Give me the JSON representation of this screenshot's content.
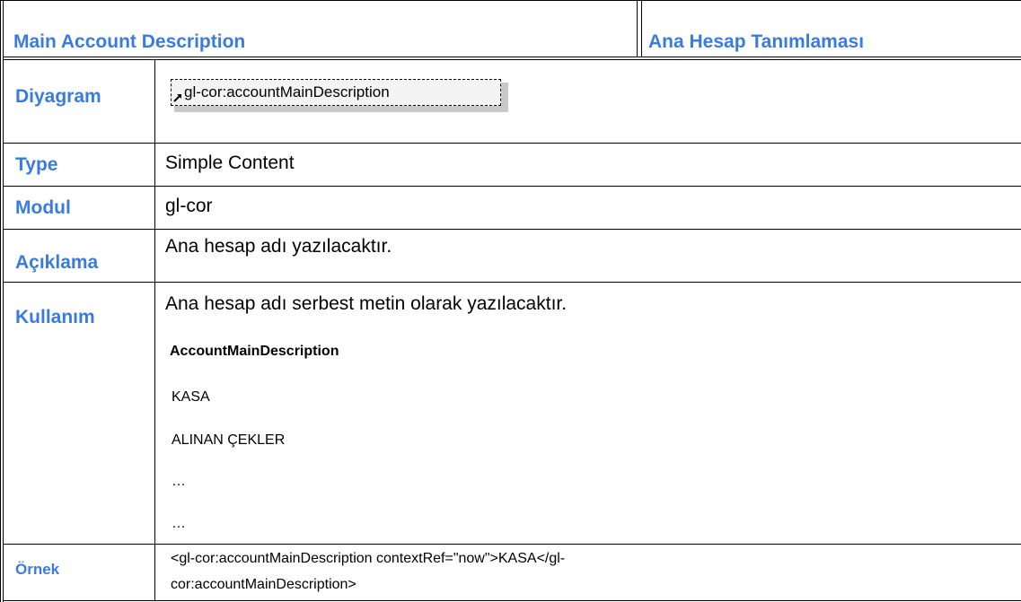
{
  "header": {
    "left_title": "Main Account Description",
    "right_title": "Ana Hesap Tanımlaması"
  },
  "rows": {
    "diagram": {
      "label": "Diyagram",
      "element_name": "gl-cor:accountMainDescription",
      "icon": "reference-arrow-icon"
    },
    "type": {
      "label": "Type",
      "value": "Simple Content"
    },
    "modul": {
      "label": "Modul",
      "value": "gl-cor"
    },
    "aciklama": {
      "label": "Açıklama",
      "value": "Ana hesap adı yazılacaktır."
    },
    "kullanim": {
      "label": "Kullanım",
      "value": "Ana hesap adı serbest metin olarak yazılacaktır.",
      "example_heading": "AccountMainDescription",
      "example_items": [
        "KASA",
        "ALINAN ÇEKLER",
        "…",
        "…"
      ]
    },
    "ornek": {
      "label": "Örnek",
      "line1": "<gl-cor:accountMainDescription contextRef=\"now\">KASA</gl-",
      "line2": "cor:accountMainDescription>"
    }
  },
  "colors": {
    "label_blue": "#3a7be0",
    "border": "#000000",
    "diagram_fill": "#f4f4f4",
    "diagram_shadow": "#c8c8c8"
  }
}
